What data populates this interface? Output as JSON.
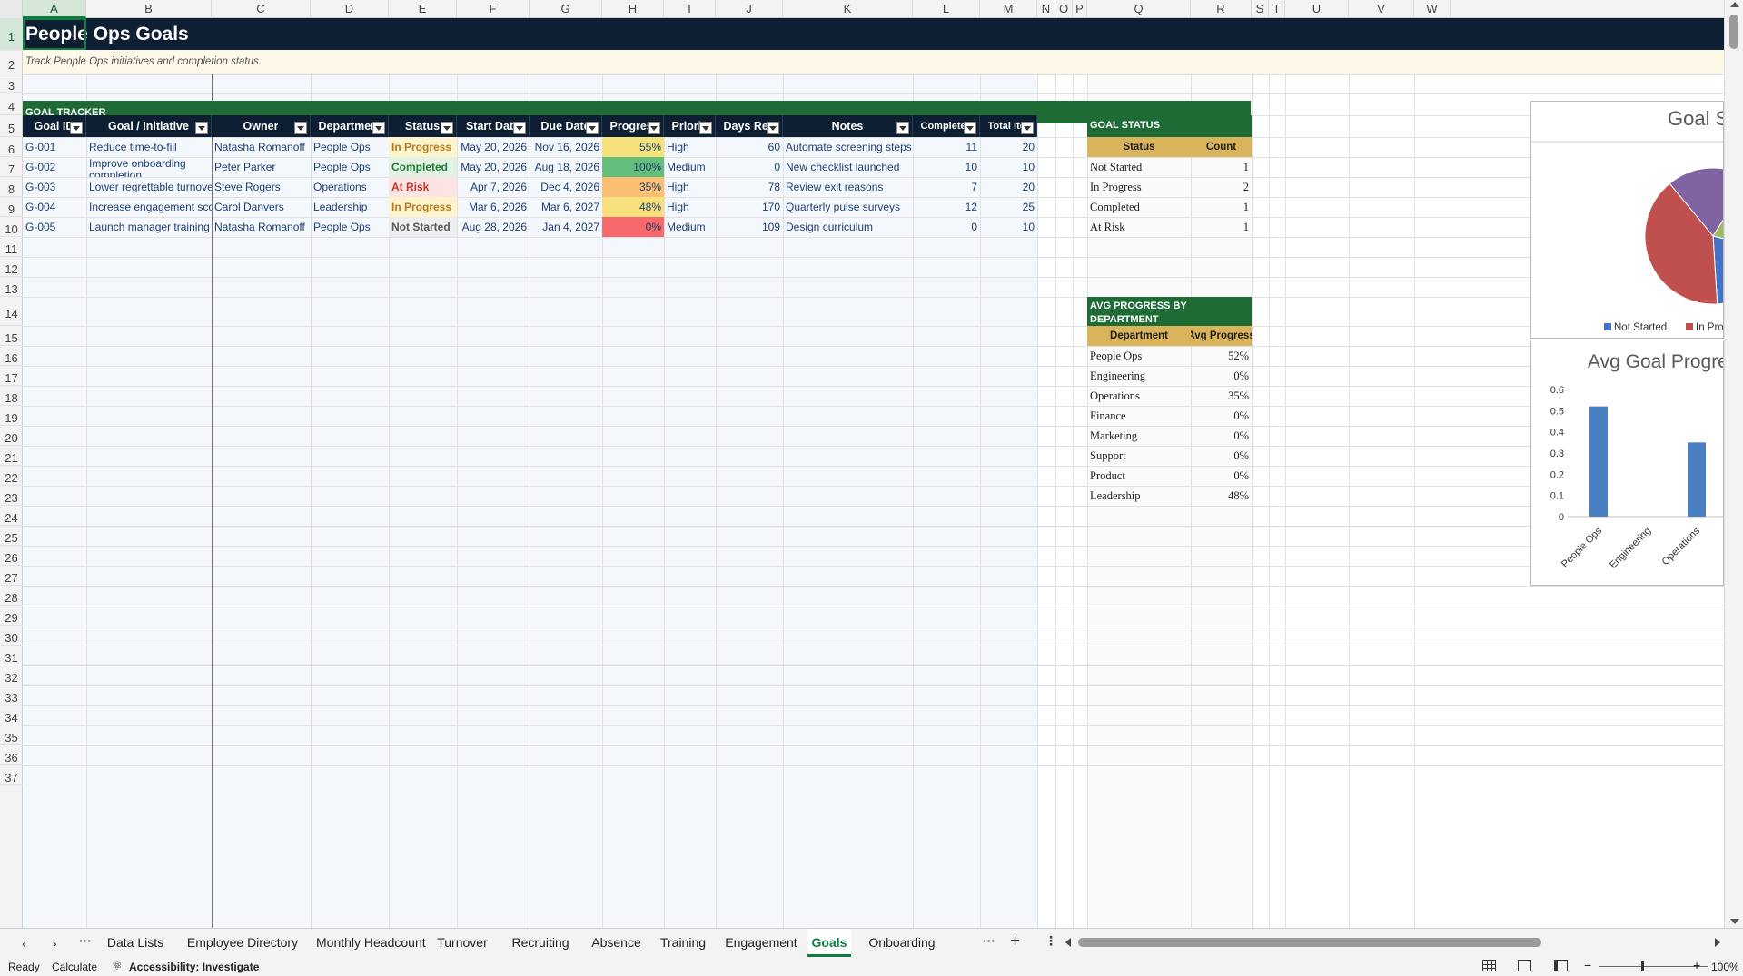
{
  "columns": [
    "A",
    "B",
    "C",
    "D",
    "E",
    "F",
    "G",
    "H",
    "I",
    "J",
    "K",
    "L",
    "M",
    "N",
    "O",
    "P",
    "Q",
    "R",
    "S",
    "T",
    "U",
    "V",
    "W"
  ],
  "rows": [
    "1",
    "2",
    "3",
    "4",
    "5",
    "6",
    "7",
    "8",
    "9",
    "10",
    "11",
    "12",
    "13",
    "14",
    "15",
    "16",
    "17",
    "18",
    "19",
    "20",
    "21",
    "22",
    "23",
    "24",
    "25",
    "26",
    "27",
    "28",
    "29",
    "30",
    "31",
    "32",
    "33",
    "34",
    "35",
    "36",
    "37"
  ],
  "sheet": {
    "title": "People Ops Goals",
    "subtitle": "Track People Ops initiatives and completion status.",
    "section": "GOAL TRACKER",
    "headers": [
      "Goal ID",
      "Goal / Initiative",
      "Owner",
      "Department",
      "Status",
      "Start Date",
      "Due Date",
      "Progress %",
      "Priority",
      "Days Remaining",
      "Notes",
      "Completed Items",
      "Total Items"
    ],
    "goals": [
      {
        "id": "G-001",
        "goal": "Reduce time-to-fill",
        "owner": "Natasha Romanoff",
        "dept": "People Ops",
        "status": "In Progress",
        "start": "May 20, 2026",
        "due": "Nov 16, 2026",
        "progress": "55%",
        "priority": "High",
        "days": "60",
        "notes": "Automate screening steps",
        "completed": "11",
        "total": "20"
      },
      {
        "id": "G-002",
        "goal": "Improve onboarding completion",
        "owner": "Peter Parker",
        "dept": "People Ops",
        "status": "Completed",
        "start": "May 20, 2026",
        "due": "Aug 18, 2026",
        "progress": "100%",
        "priority": "Medium",
        "days": "0",
        "notes": "New checklist launched",
        "completed": "10",
        "total": "10"
      },
      {
        "id": "G-003",
        "goal": "Lower regrettable turnover",
        "owner": "Steve Rogers",
        "dept": "Operations",
        "status": "At Risk",
        "start": "Apr 7, 2026",
        "due": "Dec 4, 2026",
        "progress": "35%",
        "priority": "High",
        "days": "78",
        "notes": "Review exit reasons",
        "completed": "7",
        "total": "20"
      },
      {
        "id": "G-004",
        "goal": "Increase engagement score",
        "owner": "Carol Danvers",
        "dept": "Leadership",
        "status": "In Progress",
        "start": "Mar 6, 2026",
        "due": "Mar 6, 2027",
        "progress": "48%",
        "priority": "High",
        "days": "170",
        "notes": "Quarterly pulse surveys",
        "completed": "12",
        "total": "25"
      },
      {
        "id": "G-005",
        "goal": "Launch manager training",
        "owner": "Natasha Romanoff",
        "dept": "People Ops",
        "status": "Not Started",
        "start": "Aug 28, 2026",
        "due": "Jan 4, 2027",
        "progress": "0%",
        "priority": "Medium",
        "days": "109",
        "notes": "Design curriculum",
        "completed": "0",
        "total": "10"
      }
    ],
    "goal_status": {
      "title": "GOAL STATUS",
      "headers": [
        "Status",
        "Count"
      ],
      "rows": [
        {
          "label": "Not Started",
          "value": "1"
        },
        {
          "label": "In Progress",
          "value": "2"
        },
        {
          "label": "Completed",
          "value": "1"
        },
        {
          "label": "At Risk",
          "value": "1"
        }
      ]
    },
    "avg_progress": {
      "title": "AVG PROGRESS BY DEPARTMENT",
      "headers": [
        "Department",
        "Avg Progress"
      ],
      "rows": [
        {
          "label": "People Ops",
          "value": "52%"
        },
        {
          "label": "Engineering",
          "value": "0%"
        },
        {
          "label": "Operations",
          "value": "35%"
        },
        {
          "label": "Finance",
          "value": "0%"
        },
        {
          "label": "Marketing",
          "value": "0%"
        },
        {
          "label": "Support",
          "value": "0%"
        },
        {
          "label": "Product",
          "value": "0%"
        },
        {
          "label": "Leadership",
          "value": "48%"
        }
      ]
    }
  },
  "chart_data": [
    {
      "type": "pie",
      "title": "Goal S",
      "categories": [
        "Not Started",
        "In Progress",
        "Completed",
        "At Risk"
      ],
      "values": [
        1,
        2,
        1,
        1
      ],
      "legend": [
        "Not Started",
        "In Prog"
      ],
      "colors": [
        "#4472c4",
        "#c0504d",
        "#9bbb59",
        "#8064a2"
      ]
    },
    {
      "type": "bar",
      "title": "Avg Goal Progre",
      "categories": [
        "People Ops",
        "Engineering",
        "Operations",
        "Financ"
      ],
      "values": [
        0.52,
        0,
        0.35,
        0
      ],
      "yticks": [
        "0.6",
        "0.5",
        "0.4",
        "0.3",
        "0.2",
        "0.1",
        "0"
      ],
      "ylim": [
        0,
        0.6
      ],
      "color": "#4a7fc1"
    }
  ],
  "tabs": [
    "Data Lists",
    "Employee Directory",
    "Monthly Headcount",
    "Turnover",
    "Recruiting",
    "Absence",
    "Training",
    "Engagement",
    "Goals",
    "Onboarding"
  ],
  "active_tab": "Goals",
  "status": {
    "ready": "Ready",
    "calculate": "Calculate",
    "accessibility": "Accessibility: Investigate",
    "zoom": "100%"
  },
  "colors": {
    "title_bg": "#0e1f33",
    "section_green": "#1e6b35",
    "header_gold": "#d9b45a",
    "excel_green": "#107c41",
    "in_progress": "#b7791f",
    "completed": "#1e7b34",
    "at_risk": "#c0392b"
  }
}
